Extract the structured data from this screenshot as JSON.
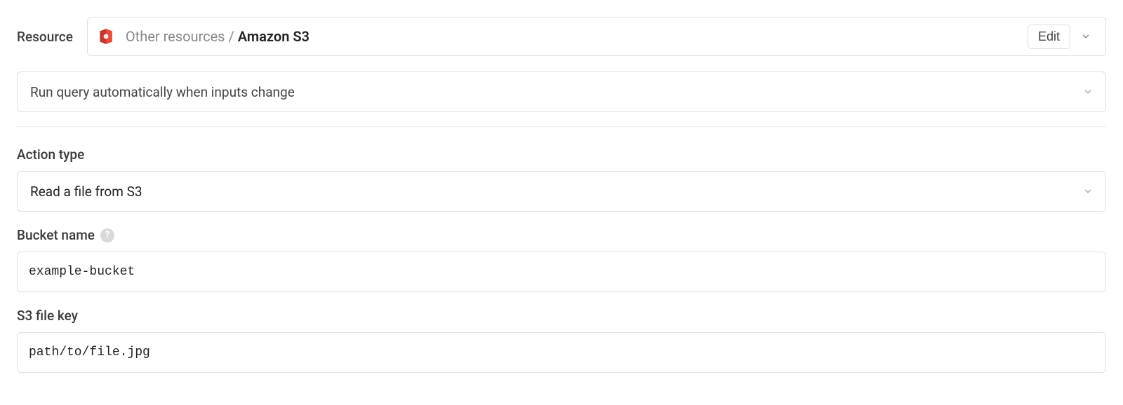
{
  "resource": {
    "label": "Resource",
    "category": "Other resources",
    "separator": " / ",
    "name": "Amazon S3",
    "edit_label": "Edit"
  },
  "run_mode": {
    "selected": "Run query automatically when inputs change"
  },
  "action_type": {
    "label": "Action type",
    "selected": "Read a file from S3"
  },
  "bucket_name": {
    "label": "Bucket name",
    "value": "example-bucket"
  },
  "s3_file_key": {
    "label": "S3 file key",
    "value": "path/to/file.jpg"
  }
}
